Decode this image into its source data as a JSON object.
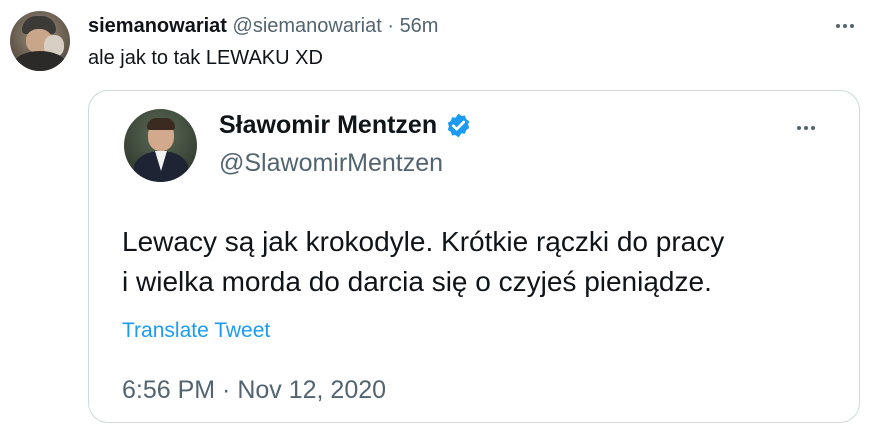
{
  "tweet": {
    "author_name": "siemanowariat",
    "author_handle": "@siemanowariat",
    "separator": "·",
    "time_ago": "56m",
    "text": "ale jak to tak LEWAKU XD"
  },
  "quoted_tweet": {
    "author_name": "Sławomir Mentzen",
    "author_handle": "@SlawomirMentzen",
    "verified_icon": "verified-badge-icon",
    "text_line1": "Lewacy są jak krokodyle. Krótkie rączki do pracy",
    "text_line2": "i wielka morda do darcia się o czyjeś pieniądze.",
    "translate_label": "Translate Tweet",
    "timestamp": "6:56 PM · Nov 12, 2020"
  },
  "colors": {
    "primary_text": "#0f1419",
    "secondary_text": "#536471",
    "link": "#1d9bf0",
    "border": "#cfd9de"
  }
}
